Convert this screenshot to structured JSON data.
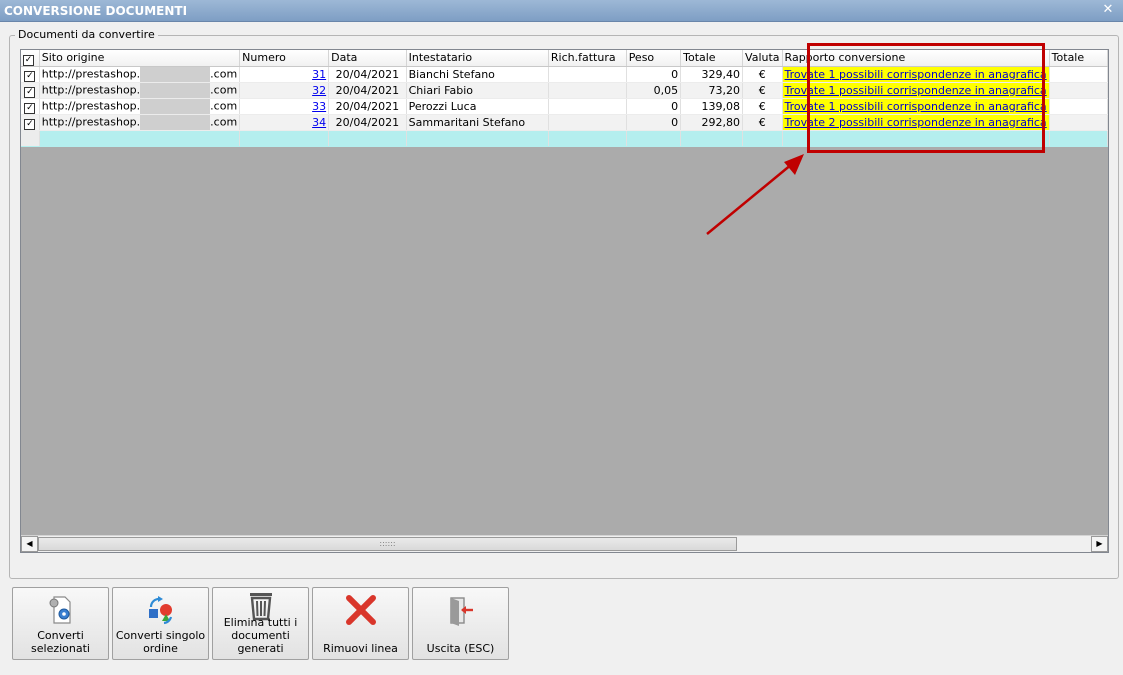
{
  "window": {
    "title": "CONVERSIONE DOCUMENTI",
    "close_glyph": "✕"
  },
  "group": {
    "legend": "Documenti da convertire"
  },
  "columns": [
    "Sito origine",
    "Numero",
    "Data",
    "Intestatario",
    "Rich.fattura",
    "Peso",
    "Totale",
    "Valuta",
    "Rapporto conversione",
    "Totale"
  ],
  "rows": [
    {
      "checked": true,
      "sito_start": "http://prestashop.",
      "sito_end": ".com",
      "numero": "31",
      "data": "20/04/2021",
      "intestatario": "Bianchi Stefano",
      "rich_fattura": "",
      "peso": "0",
      "totale": "329,40",
      "valuta": "€",
      "rapporto": "Trovate 1 possibili corrispondenze in anagrafica"
    },
    {
      "checked": true,
      "sito_start": "http://prestashop.",
      "sito_end": ".com",
      "numero": "32",
      "data": "20/04/2021",
      "intestatario": "Chiari Fabio",
      "rich_fattura": "",
      "peso": "0,05",
      "totale": "73,20",
      "valuta": "€",
      "rapporto": "Trovate 1 possibili corrispondenze in anagrafica"
    },
    {
      "checked": true,
      "sito_start": "http://prestashop.",
      "sito_end": ".com",
      "numero": "33",
      "data": "20/04/2021",
      "intestatario": "Perozzi Luca",
      "rich_fattura": "",
      "peso": "0",
      "totale": "139,08",
      "valuta": "€",
      "rapporto": "Trovate 1 possibili corrispondenze in anagrafica"
    },
    {
      "checked": true,
      "sito_start": "http://prestashop.",
      "sito_end": ".com",
      "numero": "34",
      "data": "20/04/2021",
      "intestatario": "Sammaritani Stefano",
      "rich_fattura": "",
      "peso": "0",
      "totale": "292,80",
      "valuta": "€",
      "rapporto": "Trovate 2 possibili corrispondenze in anagrafica"
    }
  ],
  "scrollbar": {
    "grip": "::::::",
    "left_arrow": "◀",
    "right_arrow": "▶"
  },
  "buttons": {
    "converti_selezionati": "Converti selezionati",
    "converti_singolo": "Converti singolo ordine",
    "elimina_tutti": "Elimina tutti i documenti generati",
    "rimuovi_linea": "Rimuovi linea",
    "uscita": "Uscita (ESC)"
  },
  "colors": {
    "highlight_yellow": "#ffff00",
    "new_row_cyan": "#b4eeee",
    "annotation_red": "#c00000"
  },
  "icons": [
    "gear-document-icon",
    "convert-shapes-icon",
    "trash-icon",
    "red-x-icon",
    "exit-door-icon"
  ]
}
